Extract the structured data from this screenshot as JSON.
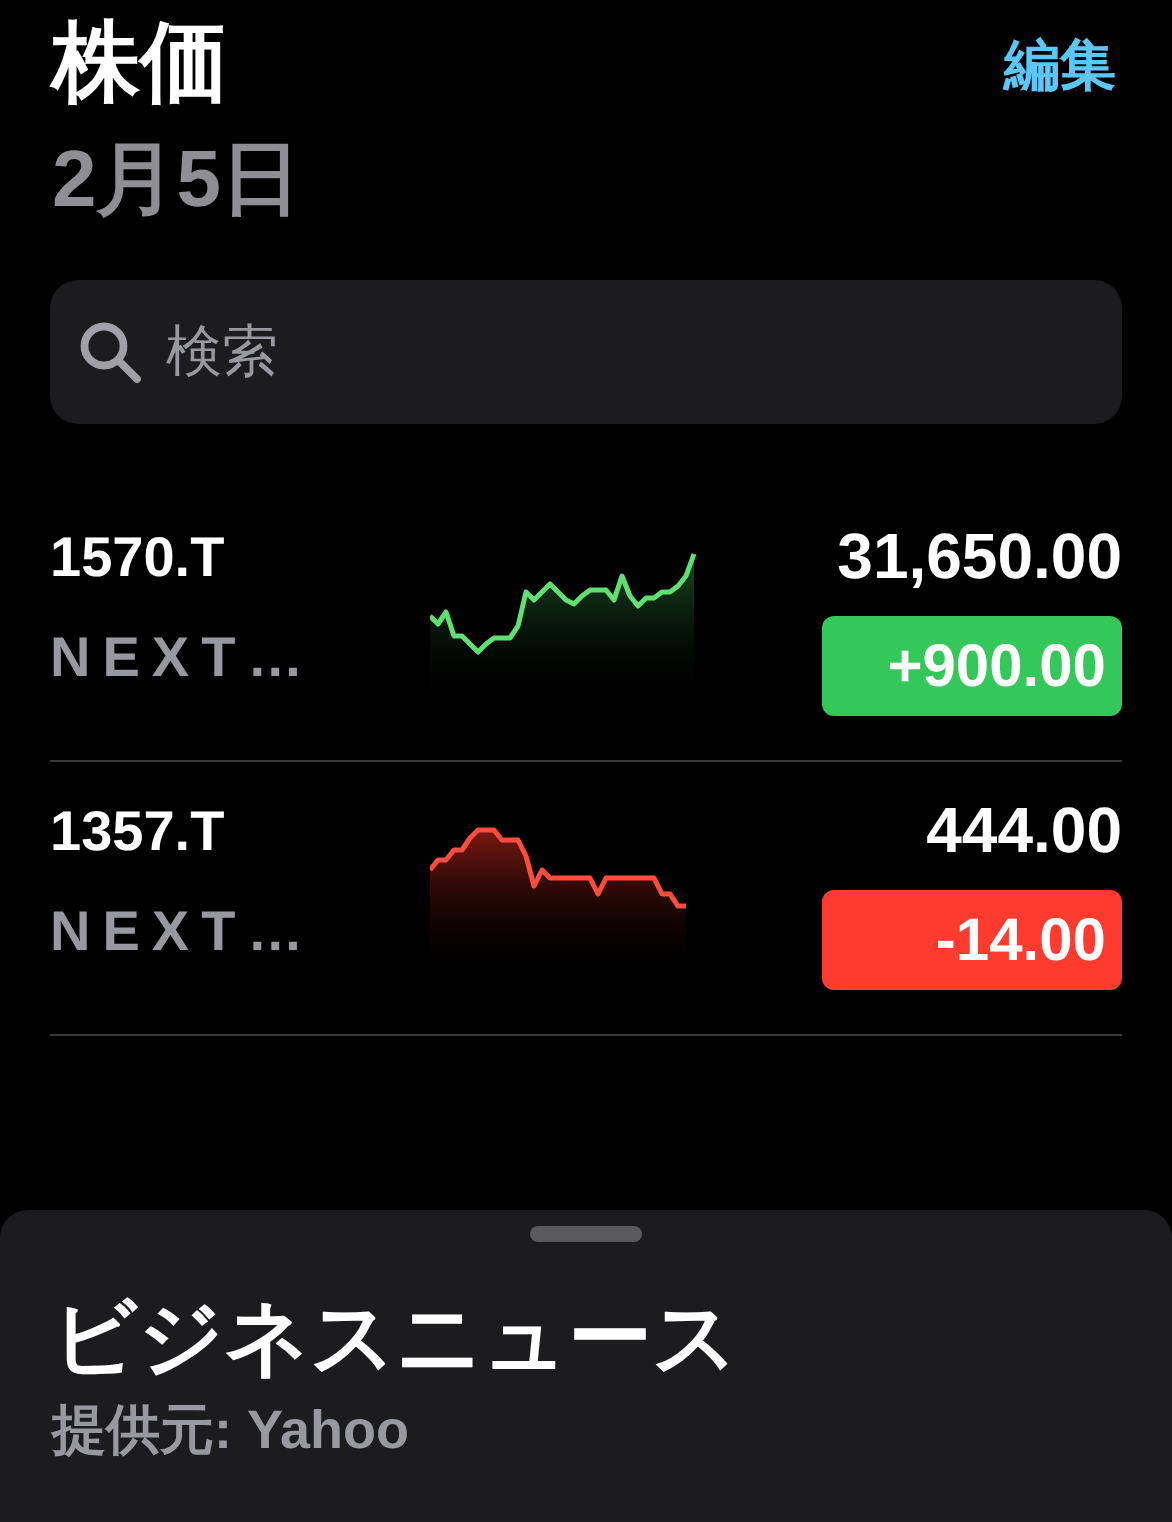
{
  "header": {
    "title": "株価",
    "date": "2月5日",
    "edit_button": "編集"
  },
  "search": {
    "placeholder": "検索"
  },
  "stocks": [
    {
      "symbol": "1570.T",
      "name": "NEXT…",
      "price": "31,650.00",
      "change": "+900.00",
      "kind": "gain"
    },
    {
      "symbol": "1357.T",
      "name": "NEXT…",
      "price": "444.00",
      "change": "-14.00",
      "kind": "loss"
    }
  ],
  "news_sheet": {
    "title": "ビジネスニュース",
    "source": "提供元: Yahoo"
  }
}
